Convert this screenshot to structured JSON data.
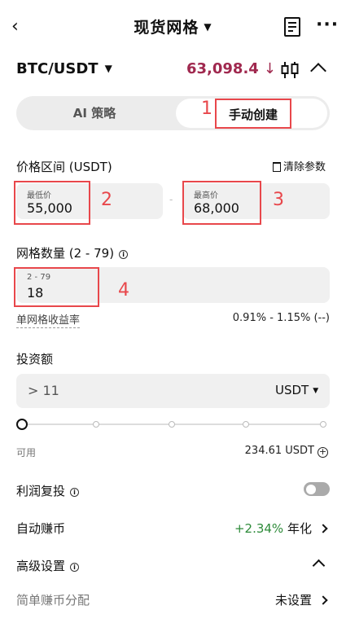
{
  "header": {
    "title": "现货网格"
  },
  "pair": {
    "symbol": "BTC/USDT",
    "price": "63,098.4",
    "price_arrow": "↓"
  },
  "mode_tabs": {
    "left": "AI 策略",
    "right": "手动创建"
  },
  "annotations": [
    "1",
    "2",
    "3",
    "4"
  ],
  "price_range": {
    "label": "价格区间 (USDT)",
    "clear_label": "清除参数",
    "min_label": "最低价",
    "min_value": "55,000",
    "separator": "-",
    "max_label": "最高价",
    "max_value": "68,000"
  },
  "grid_count": {
    "label": "网格数量 (2 - 79)",
    "range_hint": "2 - 79",
    "value": "18",
    "profit_label": "单网格收益率",
    "profit_value": "0.91% - 1.15% (--)"
  },
  "investment": {
    "label": "投资额",
    "value": "> 11",
    "unit": "USDT",
    "available_label": "可用",
    "available_value": "234.61 USDT",
    "slider_level": 0
  },
  "settings": {
    "compound_label": "利润复投",
    "compound_on": false,
    "auto_earn_label": "自动赚币",
    "auto_earn_rate": "+2.34%",
    "auto_earn_suffix": "年化",
    "advanced_label": "高级设置",
    "simple_earn_label": "简单赚币分配",
    "simple_earn_value": "未设置"
  },
  "colors": {
    "price": "#a0294f",
    "annotation": "#e8474b",
    "positive": "#2e8b3a"
  }
}
